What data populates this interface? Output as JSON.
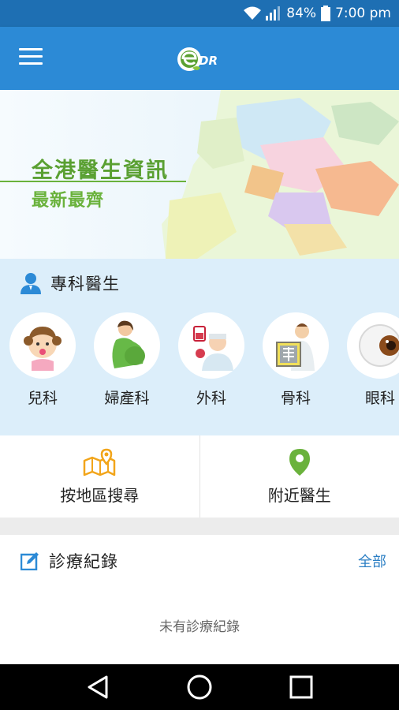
{
  "status_bar": {
    "battery": "84%",
    "time": "7:00 pm"
  },
  "app_bar": {
    "logo_text": "DR"
  },
  "banner": {
    "title": "全港醫生資訊",
    "subtitle": "最新最齊"
  },
  "specialists": {
    "heading": "專科醫生",
    "items": [
      {
        "label": "兒科",
        "icon": "child-icon"
      },
      {
        "label": "婦產科",
        "icon": "pregnant-woman-icon"
      },
      {
        "label": "外科",
        "icon": "surgeon-icon"
      },
      {
        "label": "骨科",
        "icon": "xray-icon"
      },
      {
        "label": "眼科",
        "icon": "eye-icon"
      }
    ]
  },
  "quick_links": [
    {
      "label": "按地區搜尋",
      "icon": "map-pin-icon"
    },
    {
      "label": "附近醫生",
      "icon": "location-icon"
    }
  ],
  "records": {
    "heading": "診療紀錄",
    "all_label": "全部",
    "empty_text": "未有診療紀錄"
  },
  "colors": {
    "primary": "#2c8ad6",
    "status": "#1e6fb3",
    "green": "#6ab23c",
    "light_blue": "#dceefa"
  }
}
